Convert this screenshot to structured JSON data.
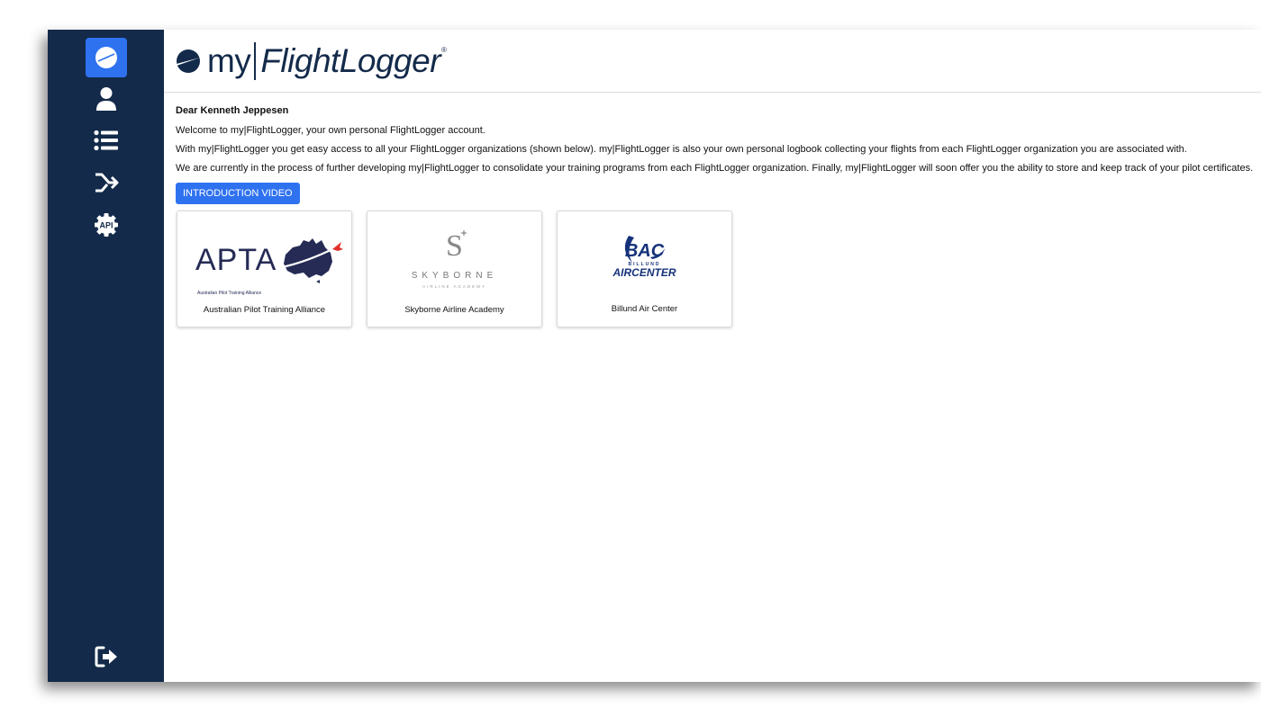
{
  "sidebar": {
    "items": [
      {
        "name": "dashboard",
        "icon": "compass-icon",
        "active": true
      },
      {
        "name": "profile",
        "icon": "user-icon",
        "active": false
      },
      {
        "name": "logbook",
        "icon": "list-icon",
        "active": false
      },
      {
        "name": "integrations",
        "icon": "merge-arrow-icon",
        "active": false
      },
      {
        "name": "api",
        "icon": "api-gear-icon",
        "label": "API",
        "active": false
      }
    ],
    "logout_icon": "logout-icon"
  },
  "header": {
    "logo_my": "my",
    "logo_flightlogger": "FlightLogger",
    "logo_registered": "®"
  },
  "content": {
    "greeting": "Dear Kenneth Jeppesen",
    "paragraphs": [
      "Welcome to my|FlightLogger, your own personal FlightLogger account.",
      "With my|FlightLogger you get easy access to all your FlightLogger organizations (shown below). my|FlightLogger is also your own personal logbook collecting your flights from each FlightLogger organization you are associated with.",
      "We are currently in the process of further developing my|FlightLogger to consolidate your training programs from each FlightLogger organization. Finally, my|FlightLogger will soon offer you the ability to store and keep track of your pilot certificates."
    ],
    "intro_button": "INTRODUCTION VIDEO"
  },
  "organizations": [
    {
      "name": "Australian Pilot Training Alliance",
      "logo_text": "APTA",
      "logo_subtext": "Australian Pilot Training Alliance"
    },
    {
      "name": "Skyborne Airline Academy",
      "logo_letter": "S",
      "logo_text": "SKYBORNE",
      "logo_subtext": "AIRLINE ACADEMY"
    },
    {
      "name": "Billund Air Center",
      "logo_text": "BAC",
      "logo_subtext": "BILLUND",
      "logo_subtext2": "AIRCENTER"
    }
  ],
  "colors": {
    "sidebar_bg": "#132a4a",
    "accent": "#2f72f0",
    "brand_navy": "#132a4a"
  }
}
